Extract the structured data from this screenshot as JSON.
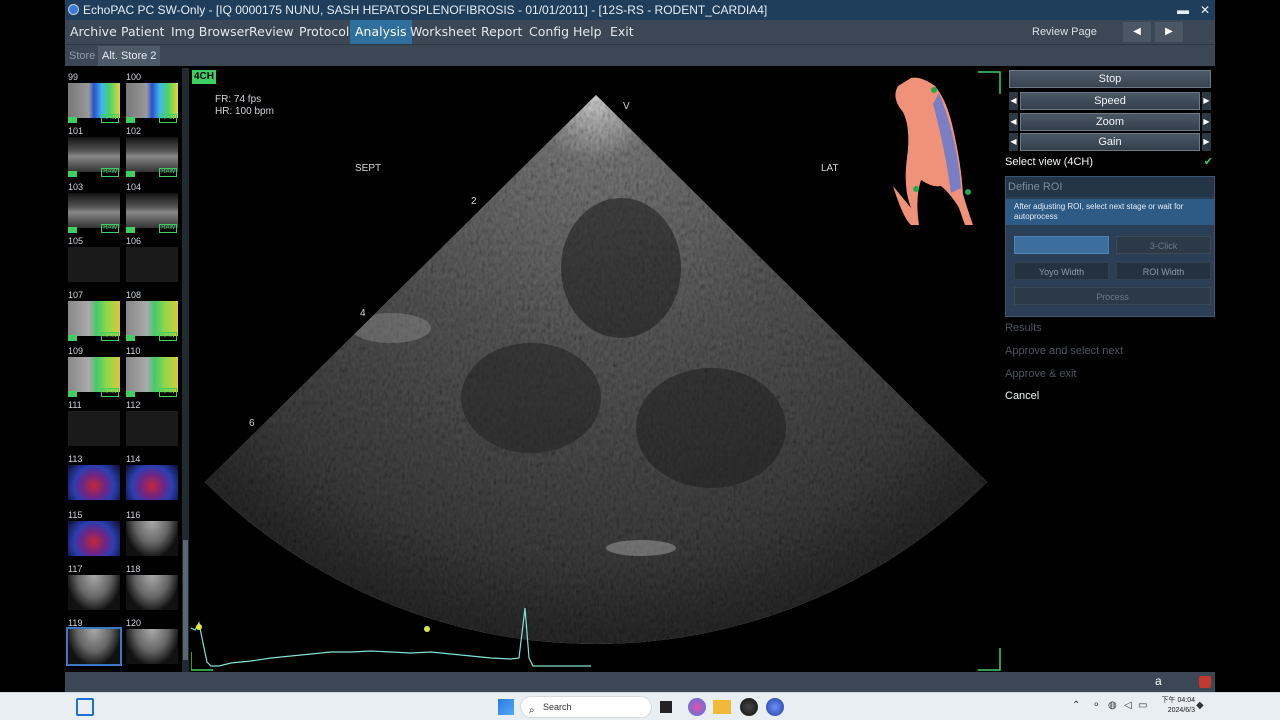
{
  "window": {
    "title": "EchoPAC PC SW-Only - [IQ 0000175 NUNU, SASH HEPATOSPLENOFIBROSIS - 01/01/2011] - [12S-RS - RODENT_CARDIA4]",
    "minimize": "▬",
    "close": "✕"
  },
  "menu": {
    "items": [
      "Archive",
      "Patient",
      "Img Browser",
      "Review",
      "Protocol",
      "Analysis",
      "Worksheet",
      "Report",
      "Config",
      "Help",
      "Exit"
    ],
    "active": "Analysis",
    "review_page": "Review Page",
    "prev_arrow": "◀",
    "next_arrow": "▶"
  },
  "stores": {
    "tabs": [
      "Store",
      "Alt. Store 2"
    ],
    "active": "Alt. Store 2"
  },
  "thumbnails": [
    {
      "num": "99",
      "kind": "color",
      "raw": true
    },
    {
      "num": "100",
      "kind": "color",
      "raw": true
    },
    {
      "num": "101",
      "kind": "gray",
      "raw": true
    },
    {
      "num": "102",
      "kind": "gray",
      "raw": true
    },
    {
      "num": "103",
      "kind": "gray",
      "raw": true
    },
    {
      "num": "104",
      "kind": "gray",
      "raw": true
    },
    {
      "num": "105",
      "kind": "dark",
      "raw": false
    },
    {
      "num": "106",
      "kind": "dark",
      "raw": false
    },
    {
      "num": "107",
      "kind": "color2",
      "raw": true
    },
    {
      "num": "108",
      "kind": "color2",
      "raw": true
    },
    {
      "num": "109",
      "kind": "color2",
      "raw": true
    },
    {
      "num": "110",
      "kind": "color2",
      "raw": true
    },
    {
      "num": "111",
      "kind": "dark",
      "raw": false
    },
    {
      "num": "112",
      "kind": "dark",
      "raw": false
    },
    {
      "num": "113",
      "kind": "doppler",
      "raw": false
    },
    {
      "num": "114",
      "kind": "doppler",
      "raw": false
    },
    {
      "num": "115",
      "kind": "doppler",
      "raw": false
    },
    {
      "num": "116",
      "kind": "sector",
      "raw": false
    },
    {
      "num": "117",
      "kind": "sector",
      "raw": false
    },
    {
      "num": "118",
      "kind": "sector",
      "raw": false
    },
    {
      "num": "119",
      "kind": "sector",
      "raw": false,
      "selected": true
    },
    {
      "num": "120",
      "kind": "sector",
      "raw": false
    }
  ],
  "raw_label": "RAW",
  "viewer": {
    "view_badge": "4CH",
    "frame_rate": "FR: 74 fps",
    "heart_rate": "HR: 100 bpm",
    "orient_v": "V",
    "label_sept": "SEPT",
    "label_lat": "LAT",
    "depth_marks": [
      "2",
      "4",
      "6"
    ]
  },
  "panel": {
    "stop": "Stop",
    "speed": "Speed",
    "zoom": "Zoom",
    "gain": "Gain",
    "left_arrow": "◀",
    "right_arrow": "▶",
    "select_view": "Select view (4CH)",
    "select_view_check": "✔",
    "define_roi": "Define ROI",
    "define_roi_msg": "After adjusting ROI, select next stage or wait for autoprocess",
    "three_click": "3-Click",
    "yoyo_width": "Yoyo Width",
    "roi_width": "ROI Width",
    "process": "Process",
    "results": "Results",
    "approve_next": "Approve and select next",
    "approve_exit": "Approve & exit",
    "cancel": "Cancel"
  },
  "taskbar": {
    "search_placeholder": "Search",
    "clock_line1": "下午 04:04",
    "clock_line2": "2024/6/3",
    "status_a": "a"
  },
  "colors": {
    "accent_green": "#3ecf63",
    "menu_active": "#2f6f9e",
    "ecg_trace": "#7fe3d6"
  }
}
